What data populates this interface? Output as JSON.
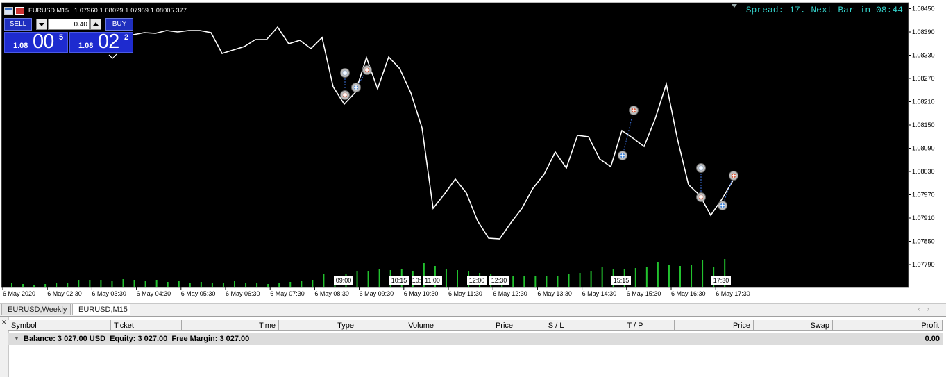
{
  "chart_header": {
    "symbol": "EURUSD,M15",
    "ohlc": "1.07960 1.08029 1.07959 1.08005  377"
  },
  "spread_info": "Spread: 17. Next Bar in 08:44",
  "one_click": {
    "sell_label": "SELL",
    "buy_label": "BUY",
    "lot_value": "0.40",
    "sell_price": {
      "prefix": "1.08",
      "big": "00",
      "sup": "5"
    },
    "buy_price": {
      "prefix": "1.08",
      "big": "02",
      "sup": "2"
    }
  },
  "price_axis": [
    "1.08450",
    "1.08390",
    "1.08330",
    "1.08270",
    "1.08210",
    "1.08150",
    "1.08090",
    "1.08030",
    "1.07970",
    "1.07910",
    "1.07850",
    "1.07790"
  ],
  "time_axis": [
    "6 May 2020",
    "6 May 02:30",
    "6 May 03:30",
    "6 May 04:30",
    "6 May 05:30",
    "6 May 06:30",
    "6 May 07:30",
    "6 May 08:30",
    "6 May 09:30",
    "6 May 10:30",
    "6 May 11:30",
    "6 May 12:30",
    "6 May 13:30",
    "6 May 14:30",
    "6 May 15:30",
    "6 May 16:30",
    "6 May 17:30"
  ],
  "trade_time_labels": [
    "09:00",
    "10:15",
    "10:",
    "11:00",
    "12:00",
    "12:30",
    "15:15",
    "17:30"
  ],
  "colors": {
    "chart_bg": "#000000",
    "price_line": "#ffffff",
    "volume": "#22c22e",
    "spread_text": "#34d0c9",
    "trade_link": "#3b6fd8",
    "buy_marker": "#3a84e0",
    "sell_marker": "#e05a3a"
  },
  "tabs": [
    {
      "label": "EURUSD,Weekly"
    },
    {
      "label": "EURUSD,M15"
    }
  ],
  "terminal": {
    "columns": [
      "Symbol",
      "Ticket",
      "Time",
      "Type",
      "Volume",
      "Price",
      "S / L",
      "T / P",
      "Price",
      "Swap",
      "Profit"
    ],
    "balance_text": "Balance: 3 027.00 USD  Equity: 3 027.00  Free Margin: 3 027.00",
    "profit_total": "0.00"
  }
}
